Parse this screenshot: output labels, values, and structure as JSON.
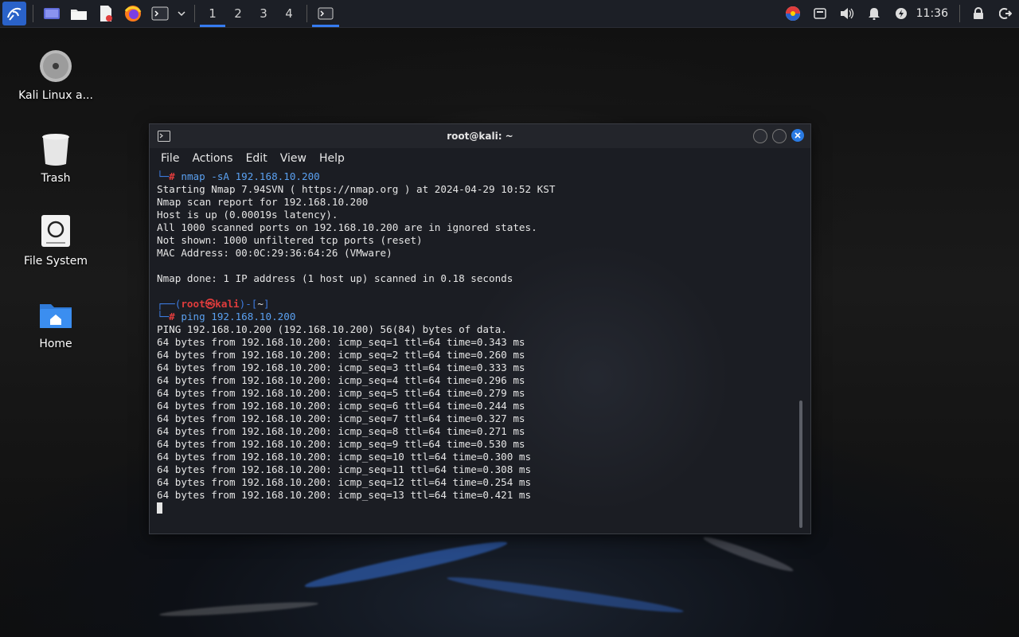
{
  "panel": {
    "workspaces": [
      "1",
      "2",
      "3",
      "4"
    ],
    "active_workspace": "1",
    "clock": "11:36"
  },
  "desktop": {
    "icons": [
      {
        "label": "Kali Linux a...",
        "icon": "disc-icon"
      },
      {
        "label": "Trash",
        "icon": "trash-icon"
      },
      {
        "label": "File System",
        "icon": "drive-icon"
      },
      {
        "label": "Home",
        "icon": "home-folder-icon"
      }
    ]
  },
  "window": {
    "title": "root@kali: ~",
    "menu": [
      "File",
      "Actions",
      "Edit",
      "View",
      "Help"
    ],
    "prompt": {
      "user": "root",
      "at": "㉿",
      "host": "kali",
      "dir": "~"
    },
    "nmap_command": "nmap -sA 192.168.10.200",
    "nmap_output": [
      "Starting Nmap 7.94SVN ( https://nmap.org ) at 2024-04-29 10:52 KST",
      "Nmap scan report for 192.168.10.200",
      "Host is up (0.00019s latency).",
      "All 1000 scanned ports on 192.168.10.200 are in ignored states.",
      "Not shown: 1000 unfiltered tcp ports (reset)",
      "MAC Address: 00:0C:29:36:64:26 (VMware)",
      "",
      "Nmap done: 1 IP address (1 host up) scanned in 0.18 seconds",
      ""
    ],
    "ping_command": "ping 192.168.10.200",
    "ping_output": [
      "PING 192.168.10.200 (192.168.10.200) 56(84) bytes of data.",
      "64 bytes from 192.168.10.200: icmp_seq=1 ttl=64 time=0.343 ms",
      "64 bytes from 192.168.10.200: icmp_seq=2 ttl=64 time=0.260 ms",
      "64 bytes from 192.168.10.200: icmp_seq=3 ttl=64 time=0.333 ms",
      "64 bytes from 192.168.10.200: icmp_seq=4 ttl=64 time=0.296 ms",
      "64 bytes from 192.168.10.200: icmp_seq=5 ttl=64 time=0.279 ms",
      "64 bytes from 192.168.10.200: icmp_seq=6 ttl=64 time=0.244 ms",
      "64 bytes from 192.168.10.200: icmp_seq=7 ttl=64 time=0.327 ms",
      "64 bytes from 192.168.10.200: icmp_seq=8 ttl=64 time=0.271 ms",
      "64 bytes from 192.168.10.200: icmp_seq=9 ttl=64 time=0.530 ms",
      "64 bytes from 192.168.10.200: icmp_seq=10 ttl=64 time=0.300 ms",
      "64 bytes from 192.168.10.200: icmp_seq=11 ttl=64 time=0.308 ms",
      "64 bytes from 192.168.10.200: icmp_seq=12 ttl=64 time=0.254 ms",
      "64 bytes from 192.168.10.200: icmp_seq=13 ttl=64 time=0.421 ms"
    ]
  },
  "colors": {
    "accent": "#367bf0",
    "prompt_user": "#e03c3c",
    "prompt_frame": "#3d7be0"
  }
}
